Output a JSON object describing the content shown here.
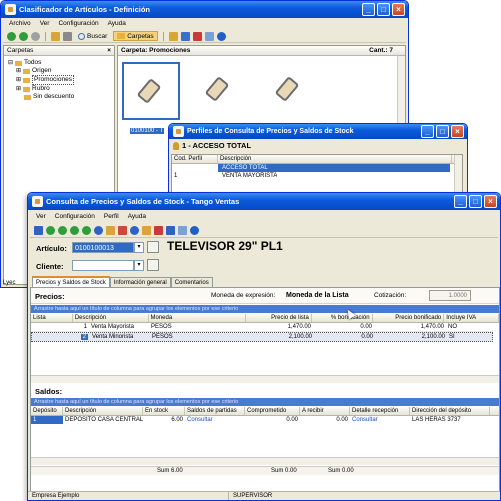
{
  "win1": {
    "title": "Clasificador de Artículos - Definición",
    "menu": [
      "Archivo",
      "Ver",
      "Configuración",
      "Ayuda"
    ],
    "toolbar": {
      "search_label": "Buscar",
      "folders_label": "Carpetas"
    },
    "folders_panel_title": "Carpetas",
    "tree": [
      "Todos",
      "Origen",
      "Promociones",
      "Rubro",
      "Sin descuento"
    ],
    "main_panel_title": "Carpeta: Promociones",
    "count_label": "Cant.: 7",
    "item_caption": "0100100 - T"
  },
  "win2": {
    "title": "Perfiles de Consulta de Precios y Saldos de Stock",
    "profile_header": "1 - ACCESO TOTAL",
    "columns": [
      "Cod. Perfil",
      "Descripción"
    ],
    "rows": [
      {
        "code": "",
        "desc": "ACCESO TOTAL",
        "selected": true
      },
      {
        "code": "1",
        "desc": "VENTA MAYORISTA",
        "selected": false
      }
    ]
  },
  "win3": {
    "title": "Consulta de Precios y Saldos de Stock - Tango Ventas",
    "menu": [
      "Ver",
      "Configuración",
      "Perfil",
      "Ayuda"
    ],
    "article_label": "Artículo:",
    "article_code": "0100100013",
    "article_desc": "TELEVISOR 29\" PL1",
    "client_label": "Cliente:",
    "client_value": "",
    "tabs": [
      "Precios y Saldos de Stock",
      "Información general",
      "Comentarios"
    ],
    "prices": {
      "title": "Precios:",
      "currency_label": "Moneda de expresión:",
      "currency_value": "Moneda de la Lista",
      "quote_label": "Cotización:",
      "quote_value": "1.0000",
      "group_hint": "Arrastre hasta aquí un título de columna para agrupar los elementos por ese criterio",
      "columns": [
        "Lista",
        "Descripción",
        "Moneda",
        "Precio de lista",
        "% bonificación",
        "Precio bonificado",
        "Incluye IVA"
      ],
      "rows": [
        {
          "lista": "1",
          "desc": "Venta Mayorista",
          "moneda": "PESOS",
          "precio": "1,470.00",
          "bonif": "0.00",
          "bonificado": "1,470.00",
          "iva": "NO"
        },
        {
          "lista": "2",
          "desc": "Venta Minorista",
          "moneda": "PESOS",
          "precio": "2,100.00",
          "bonif": "0.00",
          "bonificado": "2,100.00",
          "iva": "SI"
        }
      ]
    },
    "stock": {
      "title": "Saldos:",
      "group_hint": "Arrastre hasta aquí un título de columna para agrupar los elementos por ese criterio",
      "columns": [
        "Depósito",
        "Descripción",
        "En stock",
        "Saldos de partidas",
        "Comprometido",
        "A recibir",
        "Detalle recepción",
        "Dirección del depósito"
      ],
      "row": {
        "dep": "1",
        "desc": "DEPOSITO CASA CENTRAL",
        "stock": "6.00",
        "partidas": "Consultar",
        "comp": "0.00",
        "recibir": "0.00",
        "detalle": "Consultar",
        "direccion": "LAS HERAS 3737"
      },
      "totals": [
        "Sum 6.00",
        "Sum 0.00",
        "Sum 0.00"
      ]
    },
    "status": {
      "company": "Empresa Ejemplo",
      "user": "SUPERVISOR"
    }
  },
  "colors": {
    "xp_blue": "#0a5bdc",
    "selection": "#316ac5",
    "hint_bar": "#4a7bd2",
    "window_bg": "#ece9d8"
  },
  "win1_status_fragment": "Lyec"
}
